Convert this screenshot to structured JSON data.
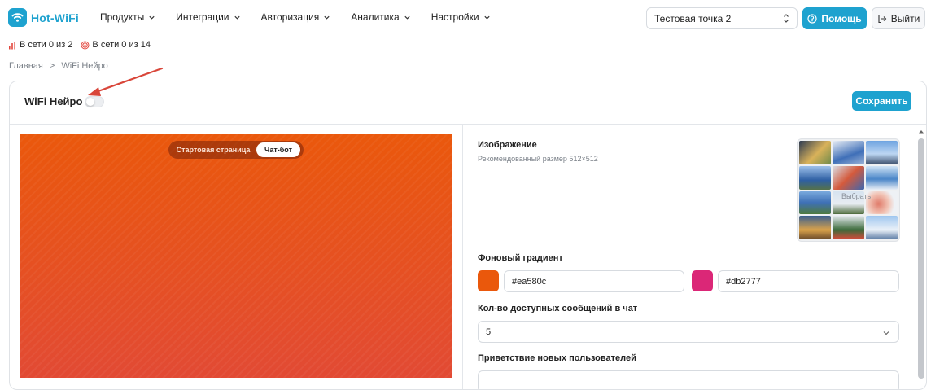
{
  "brand": {
    "name": "Hot-WiFi"
  },
  "nav": [
    {
      "label": "Продукты"
    },
    {
      "label": "Интеграции"
    },
    {
      "label": "Авторизация"
    },
    {
      "label": "Аналитика"
    },
    {
      "label": "Настройки"
    }
  ],
  "point_select": {
    "value": "Тестовая точка 2"
  },
  "help_button": {
    "label": "Помощь"
  },
  "exit_button": {
    "label": "Выйти"
  },
  "status": [
    {
      "text": "В сети 0 из 2",
      "icon": "signal-bars-icon",
      "color": "#e2453c"
    },
    {
      "text": "В сети 0 из 14",
      "icon": "broadcast-icon",
      "color": "#e2453c"
    }
  ],
  "breadcrumb": {
    "home": "Главная",
    "separator": ">",
    "current": "WiFi Нейро"
  },
  "card": {
    "title": "WiFi Нейро",
    "enabled": false,
    "save_label": "Сохранить"
  },
  "preview": {
    "tabs": [
      {
        "label": "Стартовая страница"
      },
      {
        "label": "Чат-бот"
      }
    ],
    "active_tab": "Чат-бот",
    "gradient_from": "#ea580c",
    "gradient_to": "#db2777"
  },
  "settings": {
    "image": {
      "label": "Изображение",
      "hint": "Рекомендованный размер 512×512",
      "pick_label": "Выбрать"
    },
    "gradient": {
      "label": "Фоновый градиент",
      "color1": "#ea580c",
      "color2": "#db2777"
    },
    "messages": {
      "label": "Кол-во доступных сообщений в чат",
      "value": "5"
    },
    "greeting": {
      "label": "Приветствие новых пользователей"
    }
  },
  "colors": {
    "accent": "#1ea2cf",
    "arrow": "#d9463a"
  }
}
